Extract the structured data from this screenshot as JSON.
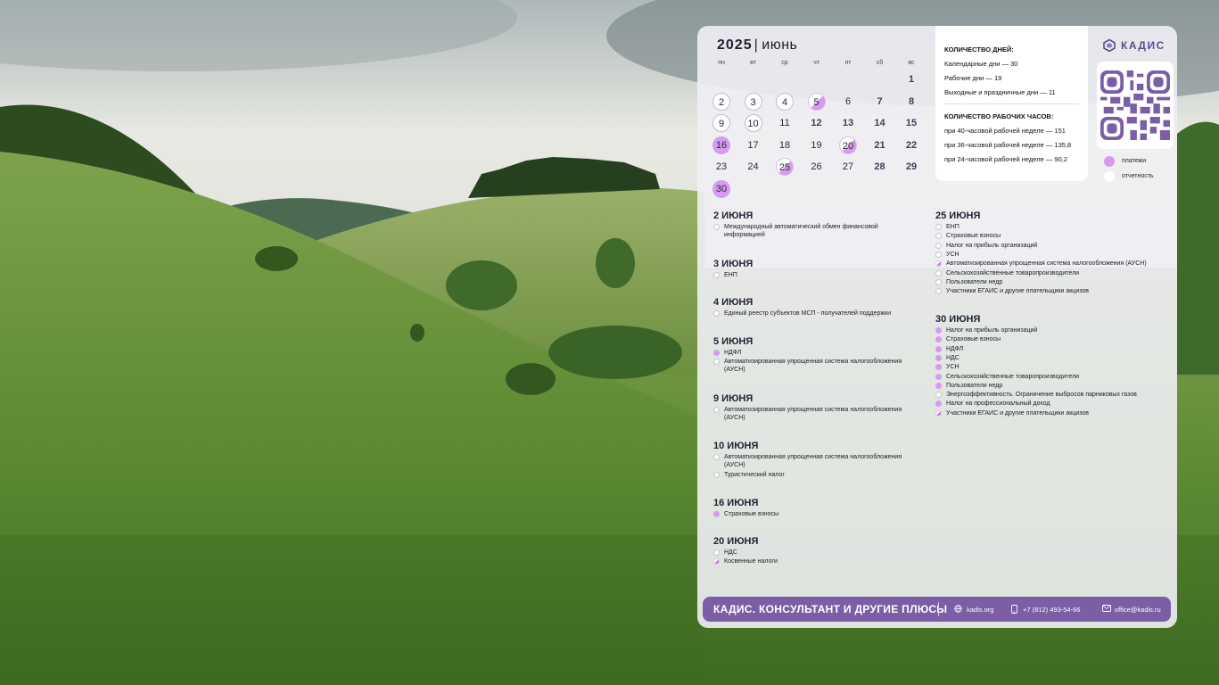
{
  "calendar": {
    "year": "2025",
    "month": "июнь",
    "weekdays": [
      "пн",
      "вт",
      "ср",
      "чт",
      "пт",
      "сб",
      "вс"
    ],
    "days": [
      {
        "d": "1",
        "col": 6,
        "row": 0,
        "weekend": true,
        "mark": ""
      },
      {
        "d": "2",
        "col": 0,
        "row": 1,
        "weekend": false,
        "mark": "rep"
      },
      {
        "d": "3",
        "col": 1,
        "row": 1,
        "weekend": false,
        "mark": "rep"
      },
      {
        "d": "4",
        "col": 2,
        "row": 1,
        "weekend": false,
        "mark": "rep"
      },
      {
        "d": "5",
        "col": 3,
        "row": 1,
        "weekend": false,
        "mark": "half"
      },
      {
        "d": "6",
        "col": 4,
        "row": 1,
        "weekend": false,
        "mark": ""
      },
      {
        "d": "7",
        "col": 5,
        "row": 1,
        "weekend": true,
        "mark": ""
      },
      {
        "d": "8",
        "col": 6,
        "row": 1,
        "weekend": true,
        "mark": ""
      },
      {
        "d": "9",
        "col": 0,
        "row": 2,
        "weekend": false,
        "mark": "rep"
      },
      {
        "d": "10",
        "col": 1,
        "row": 2,
        "weekend": false,
        "mark": "rep"
      },
      {
        "d": "11",
        "col": 2,
        "row": 2,
        "weekend": false,
        "mark": ""
      },
      {
        "d": "12",
        "col": 3,
        "row": 2,
        "weekend": true,
        "mark": ""
      },
      {
        "d": "13",
        "col": 4,
        "row": 2,
        "weekend": true,
        "mark": ""
      },
      {
        "d": "14",
        "col": 5,
        "row": 2,
        "weekend": true,
        "mark": ""
      },
      {
        "d": "15",
        "col": 6,
        "row": 2,
        "weekend": true,
        "mark": ""
      },
      {
        "d": "16",
        "col": 0,
        "row": 3,
        "weekend": false,
        "mark": "pay"
      },
      {
        "d": "17",
        "col": 1,
        "row": 3,
        "weekend": false,
        "mark": ""
      },
      {
        "d": "18",
        "col": 2,
        "row": 3,
        "weekend": false,
        "mark": ""
      },
      {
        "d": "19",
        "col": 3,
        "row": 3,
        "weekend": false,
        "mark": ""
      },
      {
        "d": "20",
        "col": 4,
        "row": 3,
        "weekend": false,
        "mark": "half"
      },
      {
        "d": "21",
        "col": 5,
        "row": 3,
        "weekend": true,
        "mark": ""
      },
      {
        "d": "22",
        "col": 6,
        "row": 3,
        "weekend": true,
        "mark": ""
      },
      {
        "d": "23",
        "col": 0,
        "row": 4,
        "weekend": false,
        "mark": ""
      },
      {
        "d": "24",
        "col": 1,
        "row": 4,
        "weekend": false,
        "mark": ""
      },
      {
        "d": "25",
        "col": 2,
        "row": 4,
        "weekend": false,
        "mark": "half"
      },
      {
        "d": "26",
        "col": 3,
        "row": 4,
        "weekend": false,
        "mark": ""
      },
      {
        "d": "27",
        "col": 4,
        "row": 4,
        "weekend": false,
        "mark": ""
      },
      {
        "d": "28",
        "col": 5,
        "row": 4,
        "weekend": true,
        "mark": ""
      },
      {
        "d": "29",
        "col": 6,
        "row": 4,
        "weekend": true,
        "mark": ""
      },
      {
        "d": "30",
        "col": 0,
        "row": 5,
        "weekend": false,
        "mark": "pay"
      }
    ]
  },
  "info": {
    "days_heading": "КОЛИЧЕСТВО ДНЕЙ:",
    "calendar_days": "Календарные дни — 30",
    "working_days": "Рабочие дни — 19",
    "holidays": "Выходные и праздничные дни — 11",
    "hours_heading": "КОЛИЧЕСТВО РАБОЧИХ ЧАСОВ:",
    "h40": "при 40-часовой рабочей неделе — 151",
    "h36": "при 36-часовой рабочей неделе — 135,8",
    "h24": "при 24-часовой рабочей неделе — 90,2"
  },
  "brand": {
    "name": "КАДИС",
    "accent": "#7b5ea5",
    "payment_color": "#d69af0"
  },
  "legend": {
    "payments": "платежи",
    "reports": "отчетность"
  },
  "deadlines_left": [
    {
      "date": "2 ИЮНЯ",
      "items": [
        {
          "t": "Международный автоматический обмен финансовой информацией",
          "k": "rep"
        }
      ]
    },
    {
      "date": "3 ИЮНЯ",
      "items": [
        {
          "t": "ЕНП",
          "k": "rep"
        }
      ]
    },
    {
      "date": "4 ИЮНЯ",
      "items": [
        {
          "t": "Единый реестр субъектов МСП - получателей поддержки",
          "k": "rep"
        }
      ]
    },
    {
      "date": "5 ИЮНЯ",
      "items": [
        {
          "t": "НДФЛ",
          "k": "pay"
        },
        {
          "t": "Автоматизированная упрощенная система налогообложения (АУСН)",
          "k": "rep"
        }
      ]
    },
    {
      "date": "9 ИЮНЯ",
      "items": [
        {
          "t": "Автоматизированная упрощенная система налогообложения (АУСН)",
          "k": "rep"
        }
      ]
    },
    {
      "date": "10 ИЮНЯ",
      "items": [
        {
          "t": "Автоматизированная упрощенная система налогообложения (АУСН)",
          "k": "rep"
        },
        {
          "t": "Туристический налог",
          "k": "rep"
        }
      ]
    },
    {
      "date": "16 ИЮНЯ",
      "items": [
        {
          "t": "Страховые взносы",
          "k": "pay"
        }
      ]
    },
    {
      "date": "20 ИЮНЯ",
      "items": [
        {
          "t": "НДС",
          "k": "rep"
        },
        {
          "t": "Косвенные налоги",
          "k": "half"
        }
      ]
    }
  ],
  "deadlines_right": [
    {
      "date": "25 ИЮНЯ",
      "items": [
        {
          "t": "ЕНП",
          "k": "rep"
        },
        {
          "t": "Страховые взносы",
          "k": "rep"
        },
        {
          "t": "Налог на прибыль организаций",
          "k": "rep"
        },
        {
          "t": "УСН",
          "k": "rep"
        },
        {
          "t": "Автоматизированная упрощенная система налогообложения (АУСН)",
          "k": "half"
        },
        {
          "t": "Сельскохозяйственные товаропроизводители",
          "k": "rep"
        },
        {
          "t": "Пользователи недр",
          "k": "rep"
        },
        {
          "t": "Участники ЕГАИС и другие плательщики акцизов",
          "k": "rep"
        }
      ]
    },
    {
      "date": "30 ИЮНЯ",
      "items": [
        {
          "t": "Налог на прибыль организаций",
          "k": "pay"
        },
        {
          "t": "Страховые взносы",
          "k": "pay"
        },
        {
          "t": "НДФЛ",
          "k": "pay"
        },
        {
          "t": "НДС",
          "k": "pay"
        },
        {
          "t": "УСН",
          "k": "pay"
        },
        {
          "t": "Сельскохозяйственные товаропроизводители",
          "k": "pay"
        },
        {
          "t": "Пользователи недр",
          "k": "pay"
        },
        {
          "t": "Энергоэффективность. Ограничение выбросов парниковых газов",
          "k": "rep"
        },
        {
          "t": "Налог на профессиональный доход",
          "k": "pay"
        },
        {
          "t": "Участники ЕГАИС и другие плательщики акцизов",
          "k": "half"
        }
      ]
    }
  ],
  "footer": {
    "title": "КАДИС. КОНСУЛЬТАНТ И ДРУГИЕ ПЛЮСЫ",
    "site": "kadis.org",
    "phone": "+7 (812) 493-54-66",
    "email": "office@kadis.ru"
  }
}
